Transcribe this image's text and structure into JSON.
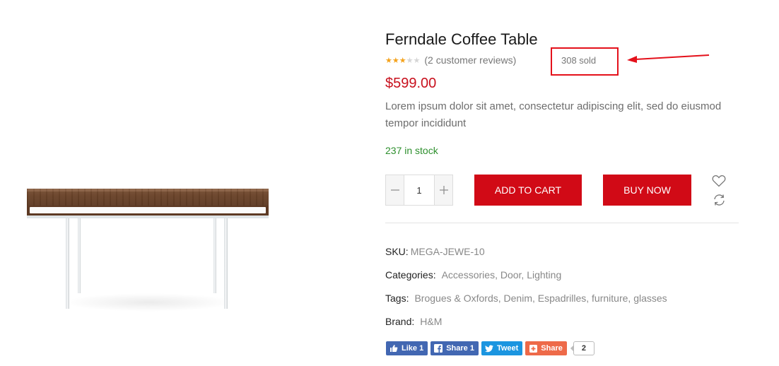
{
  "product": {
    "title": "Ferndale Coffee Table",
    "rating": 3,
    "rating_max": 5,
    "reviews_text": "(2 customer reviews)",
    "sold_text": "308 sold",
    "price": "$599.00",
    "description": "Lorem ipsum dolor sit amet, consectetur adipiscing elit, sed do eiusmod tempor incididunt",
    "stock": "237 in stock",
    "quantity": "1",
    "add_to_cart_label": "ADD TO CART",
    "buy_now_label": "BUY NOW"
  },
  "meta": {
    "sku_label": "SKU:",
    "sku_value": "MEGA-JEWE-10",
    "categories_label": "Categories:",
    "categories": [
      "Accessories",
      "Door",
      "Lighting"
    ],
    "tags_label": "Tags:",
    "tags": [
      "Brogues & Oxfords",
      "Denim",
      "Espadrilles",
      "furniture",
      "glasses"
    ],
    "brand_label": "Brand:",
    "brand_value": "H&M"
  },
  "social": {
    "like_label": "Like 1",
    "share_label": "Share 1",
    "tweet_label": "Tweet",
    "gplus_label": "Share",
    "count": "2"
  },
  "icons": {
    "wishlist": "heart-outline",
    "compare": "refresh-arrows",
    "quantity_decrease": "minus",
    "quantity_increase": "plus",
    "annotation": "red-arrow-pointing-left"
  },
  "colors": {
    "accent_red": "#d10a16",
    "price_red": "#c8101d",
    "stock_green": "#2d8f2d",
    "star_gold": "#f4a21b",
    "facebook": "#4267b2",
    "twitter": "#1b95e0",
    "gplus": "#ee6a49"
  }
}
